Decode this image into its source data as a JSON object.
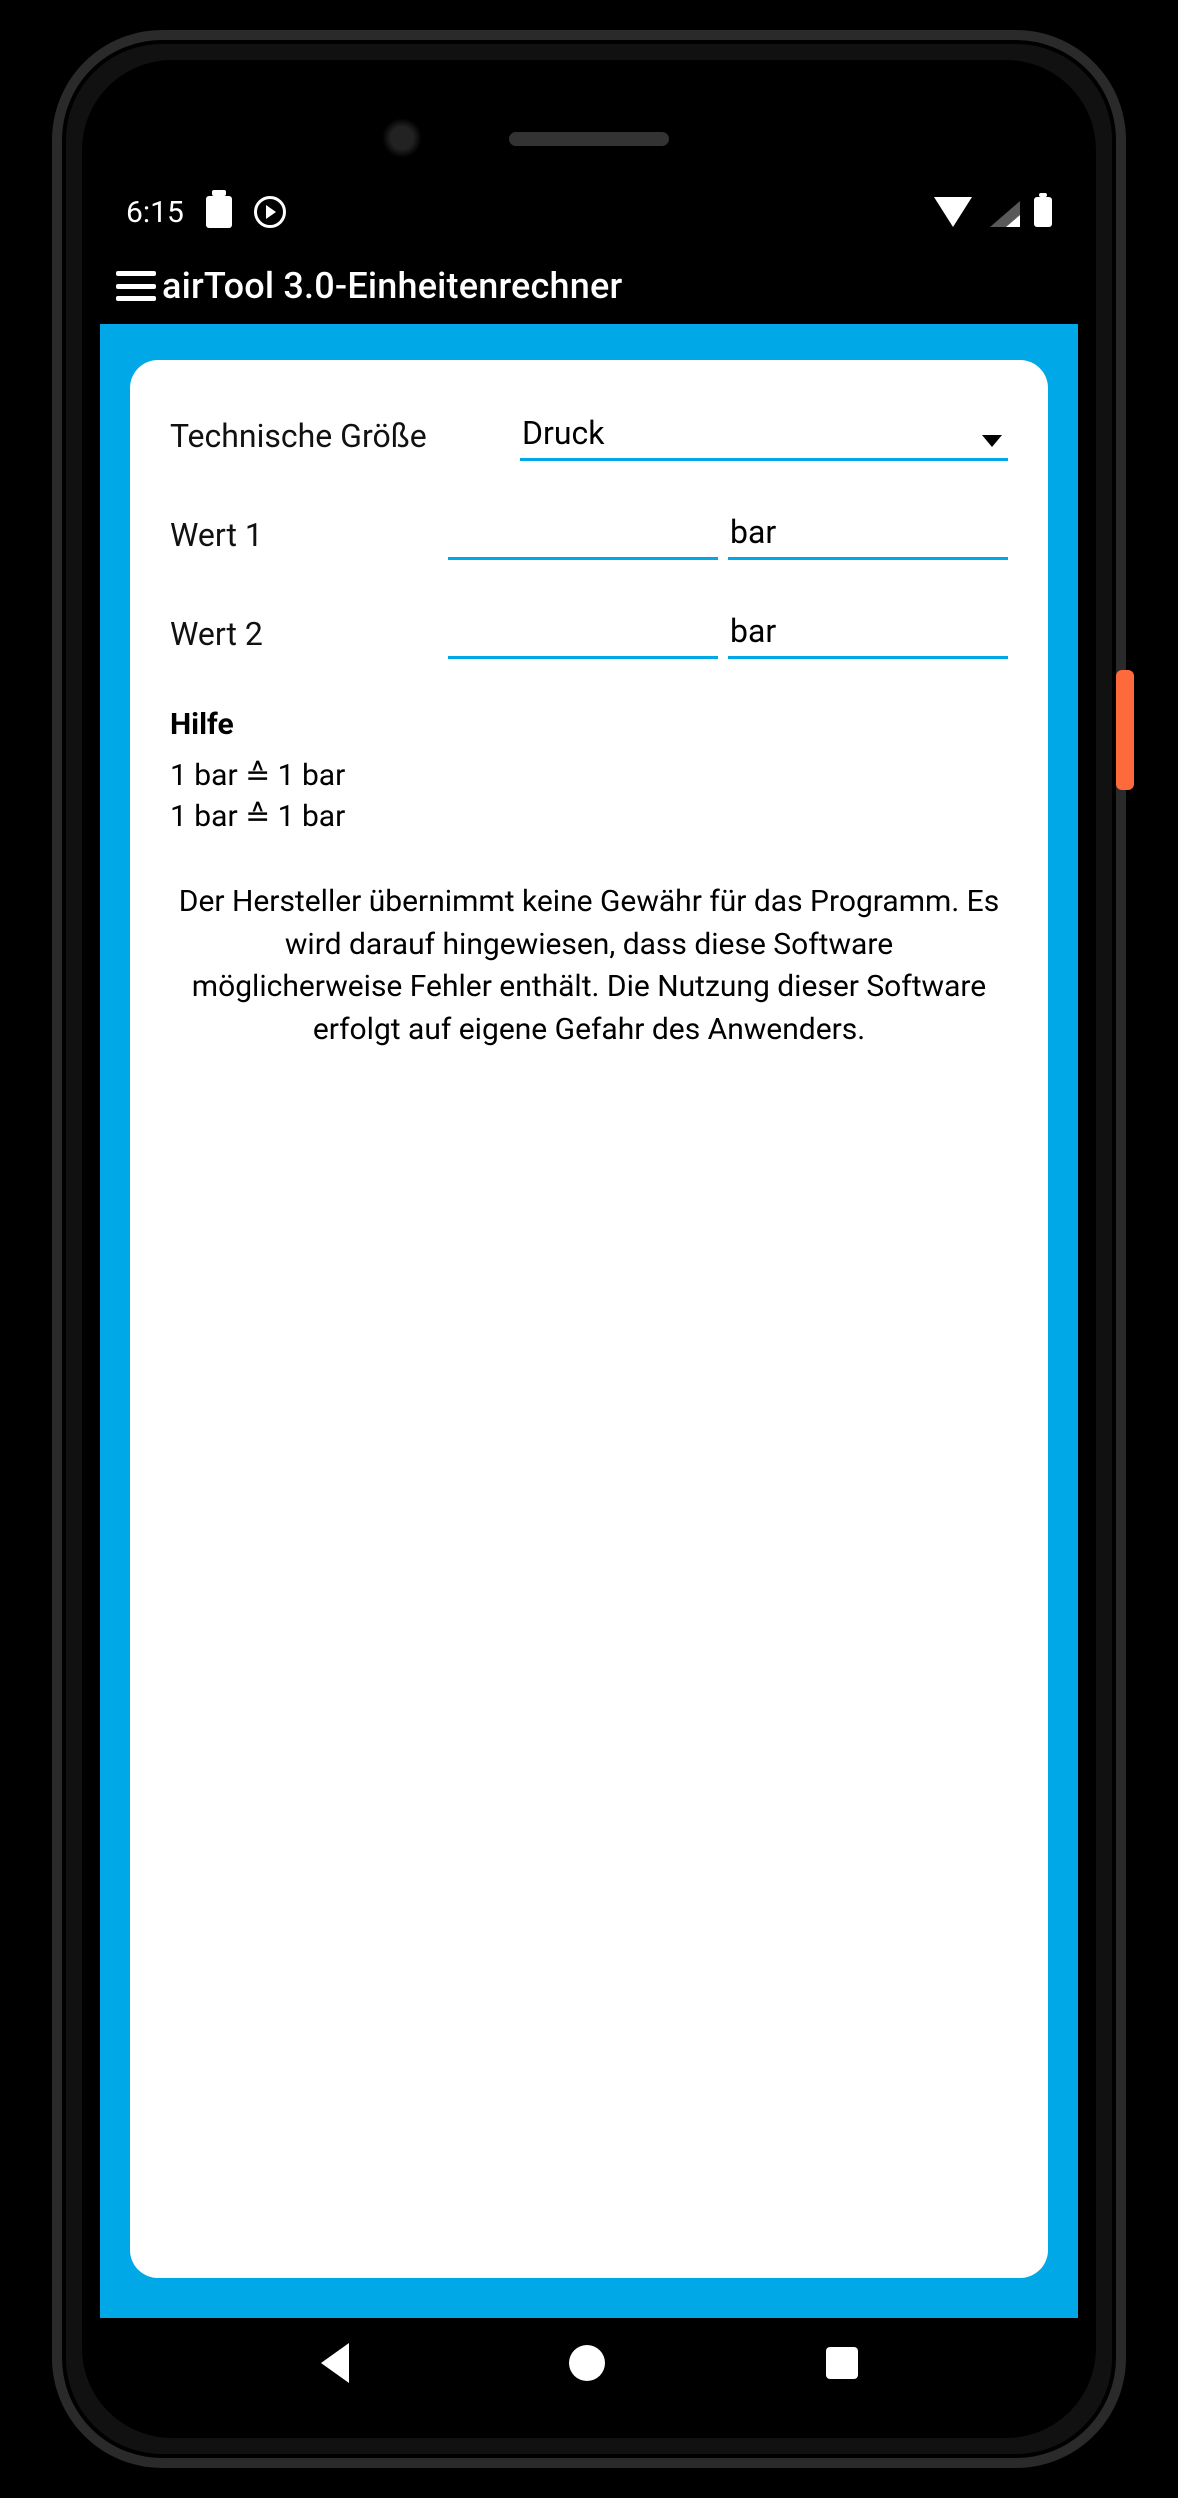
{
  "statusbar": {
    "time": "6:15"
  },
  "appbar": {
    "title": "airTool 3.0-Einheitenrechner"
  },
  "form": {
    "quantity_label": "Technische Größe",
    "quantity_value": "Druck",
    "value1_label": "Wert 1",
    "value1_unit": "bar",
    "value2_label": "Wert 2",
    "value2_unit": "bar"
  },
  "help": {
    "heading": "Hilfe",
    "line1": "1 bar ≙ 1 bar",
    "line2": "1 bar ≙ 1 bar"
  },
  "disclaimer": "Der Hersteller übernimmt keine Gewähr für das Programm. Es wird darauf hingewiesen, dass diese Software möglicherweise Fehler enthält. Die Nutzung dieser Software erfolgt auf eigene Gefahr des Anwenders."
}
